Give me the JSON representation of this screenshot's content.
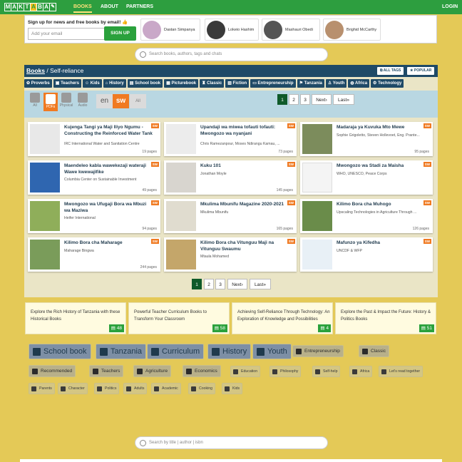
{
  "nav": {
    "logo_letters": [
      "M",
      "A",
      "K",
      "T",
      "A",
      "B",
      "A"
    ],
    "books": "BOOKS",
    "about": "ABOUT",
    "partners": "PARTNERS",
    "login": "LOGIN"
  },
  "signup": {
    "title": "Sign up for news and free books by email!",
    "placeholder": "Add your email",
    "button": "SIGN UP",
    "people": [
      "Dastan Simpanya",
      "Lokeio Hashim",
      "Mashauri Obedi",
      "Brighid McCarthy"
    ]
  },
  "search": {
    "placeholder": "Search books, authors, tags and chats"
  },
  "breadcrumb": {
    "root": "Books",
    "sep": " / ",
    "current": "Self-reliance"
  },
  "tag_buttons": {
    "all_tags": "ALL TAGS",
    "popular": "POPULAR"
  },
  "categories": [
    "Proverbs",
    "Teachers",
    "Kids",
    "History",
    "School book",
    "Picturebook",
    "Classic",
    "Fiction",
    "Entrepreneurship",
    "Tanzania",
    "Youth",
    "Africa",
    "Technology"
  ],
  "formats": [
    "All",
    "PDFs",
    "Physical",
    "Audio"
  ],
  "languages": {
    "en": "en",
    "sw": "sw",
    "all": "All"
  },
  "pagination": {
    "pages": [
      "1",
      "2",
      "3"
    ],
    "next": "Next›",
    "last": "Last»"
  },
  "books": [
    {
      "title": "Kujenga Tangi ya Maji Iliyo Ngumu - Constructing the Reinforced Water Tank",
      "author": "IRC International Water and Sanitation Centre",
      "pages": "19 pages",
      "lang": "SW"
    },
    {
      "title": "Upandaji wa miwea tofauti tofauti: Mwongozo wa nyanjani",
      "author": "Chris Ramezanpour, Moses Ndirangu Kamau, ...",
      "pages": "73 pages",
      "lang": "SW"
    },
    {
      "title": "Madaraja ya Kuvuka Mto Mewe",
      "author": "Sophie Grigoletto, Steven Hollevoet, Eng. Prante...",
      "pages": "95 pages",
      "lang": "SW"
    },
    {
      "title": "Maendeleo kabla wawekezaji wateraji Wawe kwewajifike",
      "author": "Columbia Center on Sustainable Investment",
      "pages": "49 pages",
      "lang": "SW"
    },
    {
      "title": "Kuku 101",
      "author": "Jonathan Moyle",
      "pages": "145 pages",
      "lang": "SW"
    },
    {
      "title": "Mwongozo wa Stadi za Maisha",
      "author": "WHO, UNESCO, Peace Corps",
      "pages": "",
      "lang": "SW"
    },
    {
      "title": "Mwongozo wa Ufugaji Bora wa Mbuzi wa Maziwa",
      "author": "Heifer International",
      "pages": "94 pages",
      "lang": "SW"
    },
    {
      "title": "Mkulima Mbunifu Magazine 2020-2021",
      "author": "Mkulima Mbunifu",
      "pages": "165 pages",
      "lang": "SW"
    },
    {
      "title": "Kilimo Bora cha Muhogo",
      "author": "Upscaling Technologies in Agriculture Through ...",
      "pages": "126 pages",
      "lang": "SW"
    },
    {
      "title": "Kilimo Bora cha Maharage",
      "author": "Maharage Bingwa",
      "pages": "244 pages",
      "lang": "SW"
    },
    {
      "title": "Kilimo Bora cha Vitunguu Maji na Vitunguu Swaumu",
      "author": "Mtaula Mohamed",
      "pages": "",
      "lang": "SW"
    },
    {
      "title": "Mafunzo ya Kifedha",
      "author": "UNCDF & WFP",
      "pages": "",
      "lang": "SW"
    }
  ],
  "collections": [
    {
      "text": "Explore the Rich History of Tanzania with these Historical Books",
      "count": "48"
    },
    {
      "text": "Powerful Teacher Curriculum Books to Transform Your Classroom",
      "count": "58"
    },
    {
      "text": "Achieving Self-Reliance Through Technology: An Exploration of Knowledge and Possibilities",
      "count": "4"
    },
    {
      "text": "Explore the Past & Impact the Future: History & Politics Books",
      "count": "51"
    }
  ],
  "tags_row1": [
    "School book",
    "Tanzania",
    "Curriculum",
    "History",
    "Youth",
    "Entrepreneurship",
    "Classic"
  ],
  "tags_row2": [
    "Recommended",
    "Teachers",
    "Agriculture",
    "Economics",
    "Education",
    "Philosophy",
    "Self-help",
    "Africa",
    "Let's read together"
  ],
  "tags_row3": [
    "Parents",
    "Character",
    "Politics",
    "Adults",
    "Academic",
    "Cooking",
    "Kids"
  ],
  "search2": {
    "placeholder": "Search by title | author | isbn"
  },
  "colors": {
    "green": "#2d9e3f",
    "navy": "#1f4a67",
    "orange": "#f07a22",
    "background": "#e4c957"
  }
}
